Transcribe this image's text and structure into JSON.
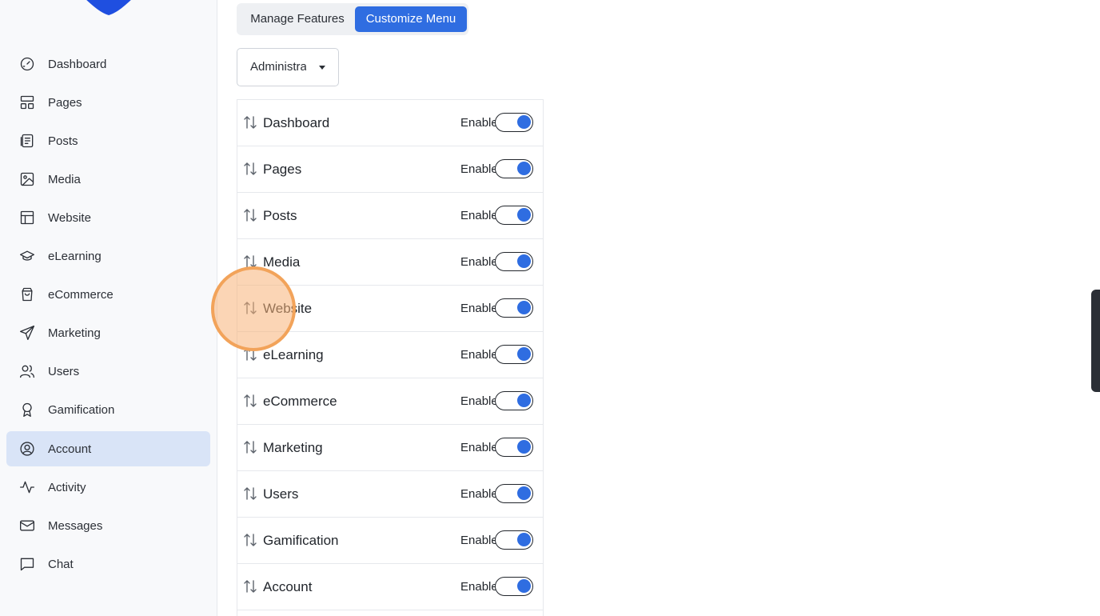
{
  "sidebar": {
    "items": [
      {
        "label": "Dashboard",
        "icon": "gauge-icon",
        "active": false
      },
      {
        "label": "Pages",
        "icon": "layout-icon",
        "active": false
      },
      {
        "label": "Posts",
        "icon": "document-icon",
        "active": false
      },
      {
        "label": "Media",
        "icon": "image-icon",
        "active": false
      },
      {
        "label": "Website",
        "icon": "window-icon",
        "active": false
      },
      {
        "label": "eLearning",
        "icon": "graduation-cap-icon",
        "active": false
      },
      {
        "label": "eCommerce",
        "icon": "shopping-bag-icon",
        "active": false
      },
      {
        "label": "Marketing",
        "icon": "paper-plane-icon",
        "active": false
      },
      {
        "label": "Users",
        "icon": "users-icon",
        "active": false
      },
      {
        "label": "Gamification",
        "icon": "award-icon",
        "active": false
      },
      {
        "label": "Account",
        "icon": "user-circle-icon",
        "active": true
      },
      {
        "label": "Activity",
        "icon": "activity-icon",
        "active": false
      },
      {
        "label": "Messages",
        "icon": "mail-icon",
        "active": false
      },
      {
        "label": "Chat",
        "icon": "chat-icon",
        "active": false
      }
    ]
  },
  "tabs": {
    "manage_label": "Manage Features",
    "customize_label": "Customize Menu",
    "active": "Customize Menu"
  },
  "role_select": {
    "value": "Administrator"
  },
  "menu_list": {
    "rows": [
      {
        "label": "Dashboard",
        "status": "Enabled",
        "enabled": true
      },
      {
        "label": "Pages",
        "status": "Enabled",
        "enabled": true
      },
      {
        "label": "Posts",
        "status": "Enabled",
        "enabled": true
      },
      {
        "label": "Media",
        "status": "Enabled",
        "enabled": true
      },
      {
        "label": "Website",
        "status": "Enabled",
        "enabled": true
      },
      {
        "label": "eLearning",
        "status": "Enabled",
        "enabled": true
      },
      {
        "label": "eCommerce",
        "status": "Enabled",
        "enabled": true
      },
      {
        "label": "Marketing",
        "status": "Enabled",
        "enabled": true
      },
      {
        "label": "Users",
        "status": "Enabled",
        "enabled": true
      },
      {
        "label": "Gamification",
        "status": "Enabled",
        "enabled": true
      },
      {
        "label": "Account",
        "status": "Enabled",
        "enabled": true
      }
    ]
  },
  "colors": {
    "accent": "#2f6de1",
    "active_nav": "#d9e4f7",
    "click_marker": "#f2a35a"
  }
}
